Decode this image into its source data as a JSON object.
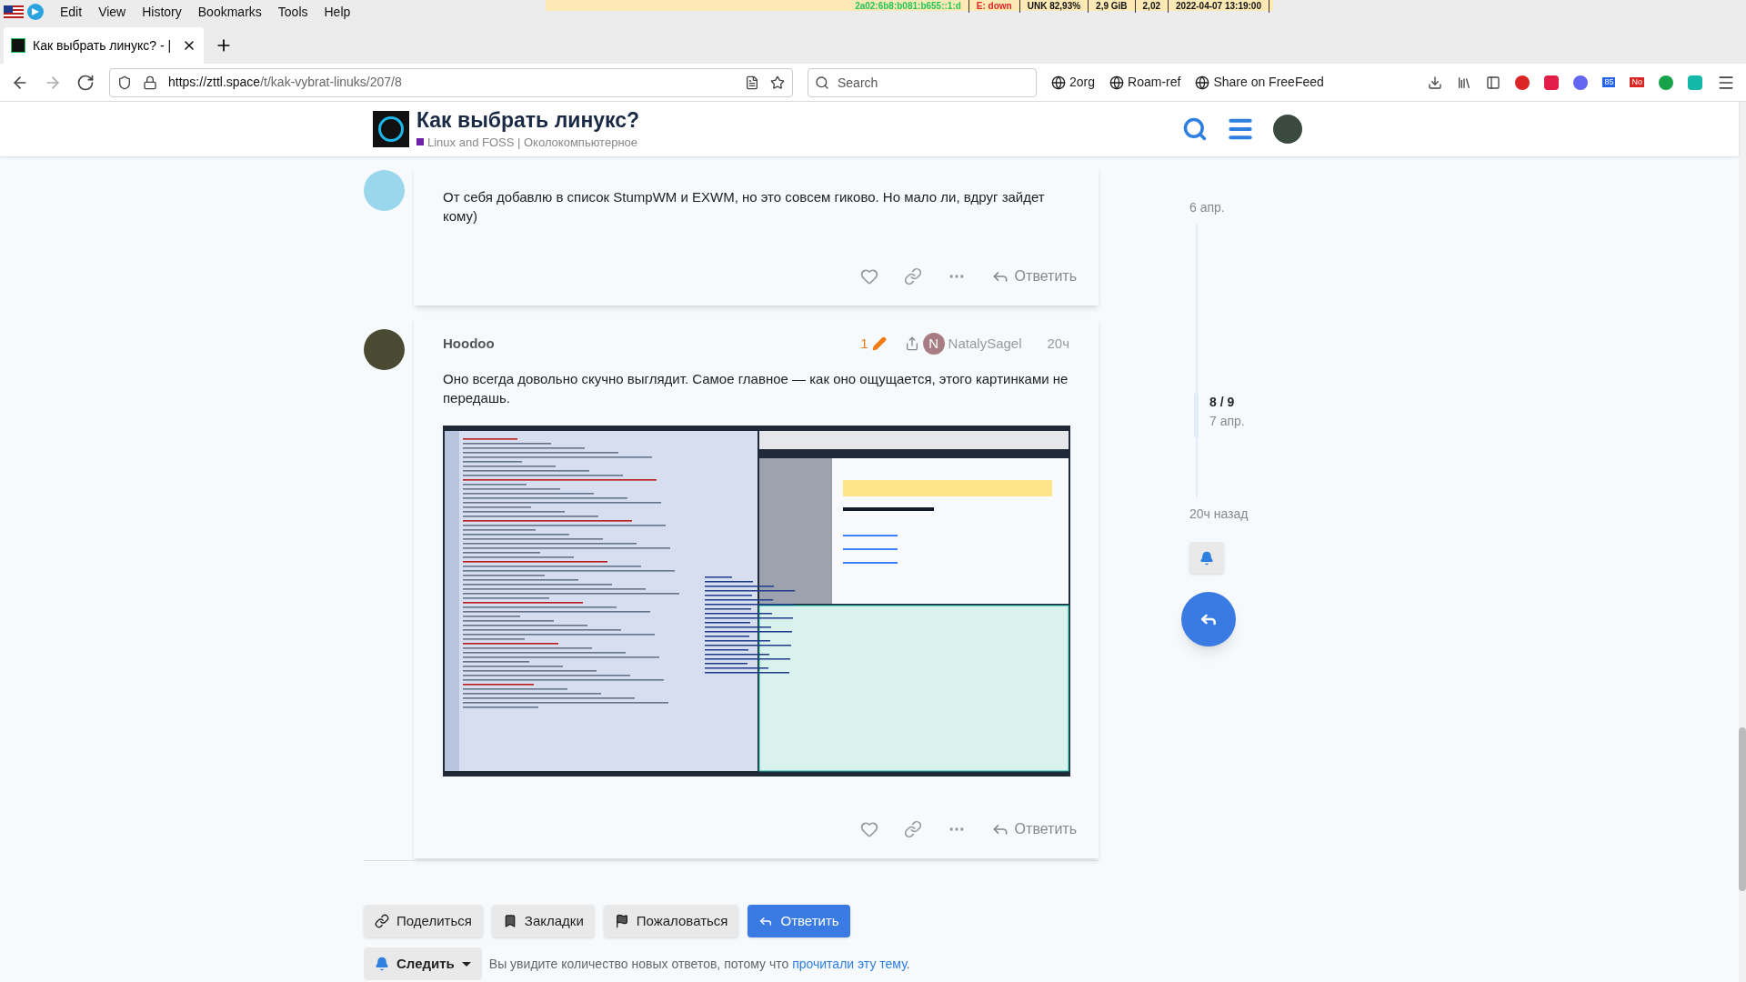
{
  "status_bar": [
    {
      "text": "2a02:6b8:b081:b655::1:d",
      "color": "#22c55e"
    },
    {
      "text": "E: down",
      "color": "#dc2626"
    },
    {
      "text": "UNK 82,93%",
      "color": "#111111"
    },
    {
      "text": "2,9 GiB",
      "color": "#111111"
    },
    {
      "text": "2,02",
      "color": "#111111"
    },
    {
      "text": "2022-04-07 13:19:00",
      "color": "#111111"
    }
  ],
  "menu": [
    "Edit",
    "View",
    "History",
    "Bookmarks",
    "Tools",
    "Help"
  ],
  "tab": {
    "title": "Как выбрать линукс? - |"
  },
  "address": {
    "host": "https://zttl.space",
    "path": "/t/kak-vybrat-linuks/207/8"
  },
  "search": {
    "placeholder": "Search"
  },
  "bookmarks": [
    "2org",
    "Roam-ref",
    "Share on FreeFeed"
  ],
  "toolbar_badges": [
    "85",
    "No"
  ],
  "header": {
    "title": "Как выбрать линукс?",
    "category": "Linux and FOSS | Околокомпьютерное"
  },
  "posts": [
    {
      "text": "От себя добавлю в список StumpWM и EXWM, но это совсем гиково. Но мало ли, вдруг зайдет кому)",
      "reply_label": "Ответить"
    },
    {
      "author": "Hoodoo",
      "edits": "1",
      "reply_to": {
        "initial": "N",
        "name": "NatalySagel"
      },
      "time": "20ч",
      "text": "Оно всегда довольно скучно выглядит. Самое главное — как оно ощущается, этого картинками не передашь.",
      "attachments": [
        {
          "kind": "screenshot"
        }
      ],
      "reply_label": "Ответить"
    }
  ],
  "timeline": {
    "start": "6 апр.",
    "position": "8 / 9",
    "position_date": "7 апр.",
    "end": "20ч назад"
  },
  "footer_buttons": [
    {
      "label": "Поделиться",
      "kind": "share"
    },
    {
      "label": "Закладки",
      "kind": "bookmark"
    },
    {
      "label": "Пожаловаться",
      "kind": "flag"
    },
    {
      "label": "Ответить",
      "kind": "reply"
    }
  ],
  "notifications": {
    "button": "Следить",
    "text": "Вы увидите количество новых ответов, потому что",
    "link": "прочитали эту тему",
    "end": "."
  }
}
